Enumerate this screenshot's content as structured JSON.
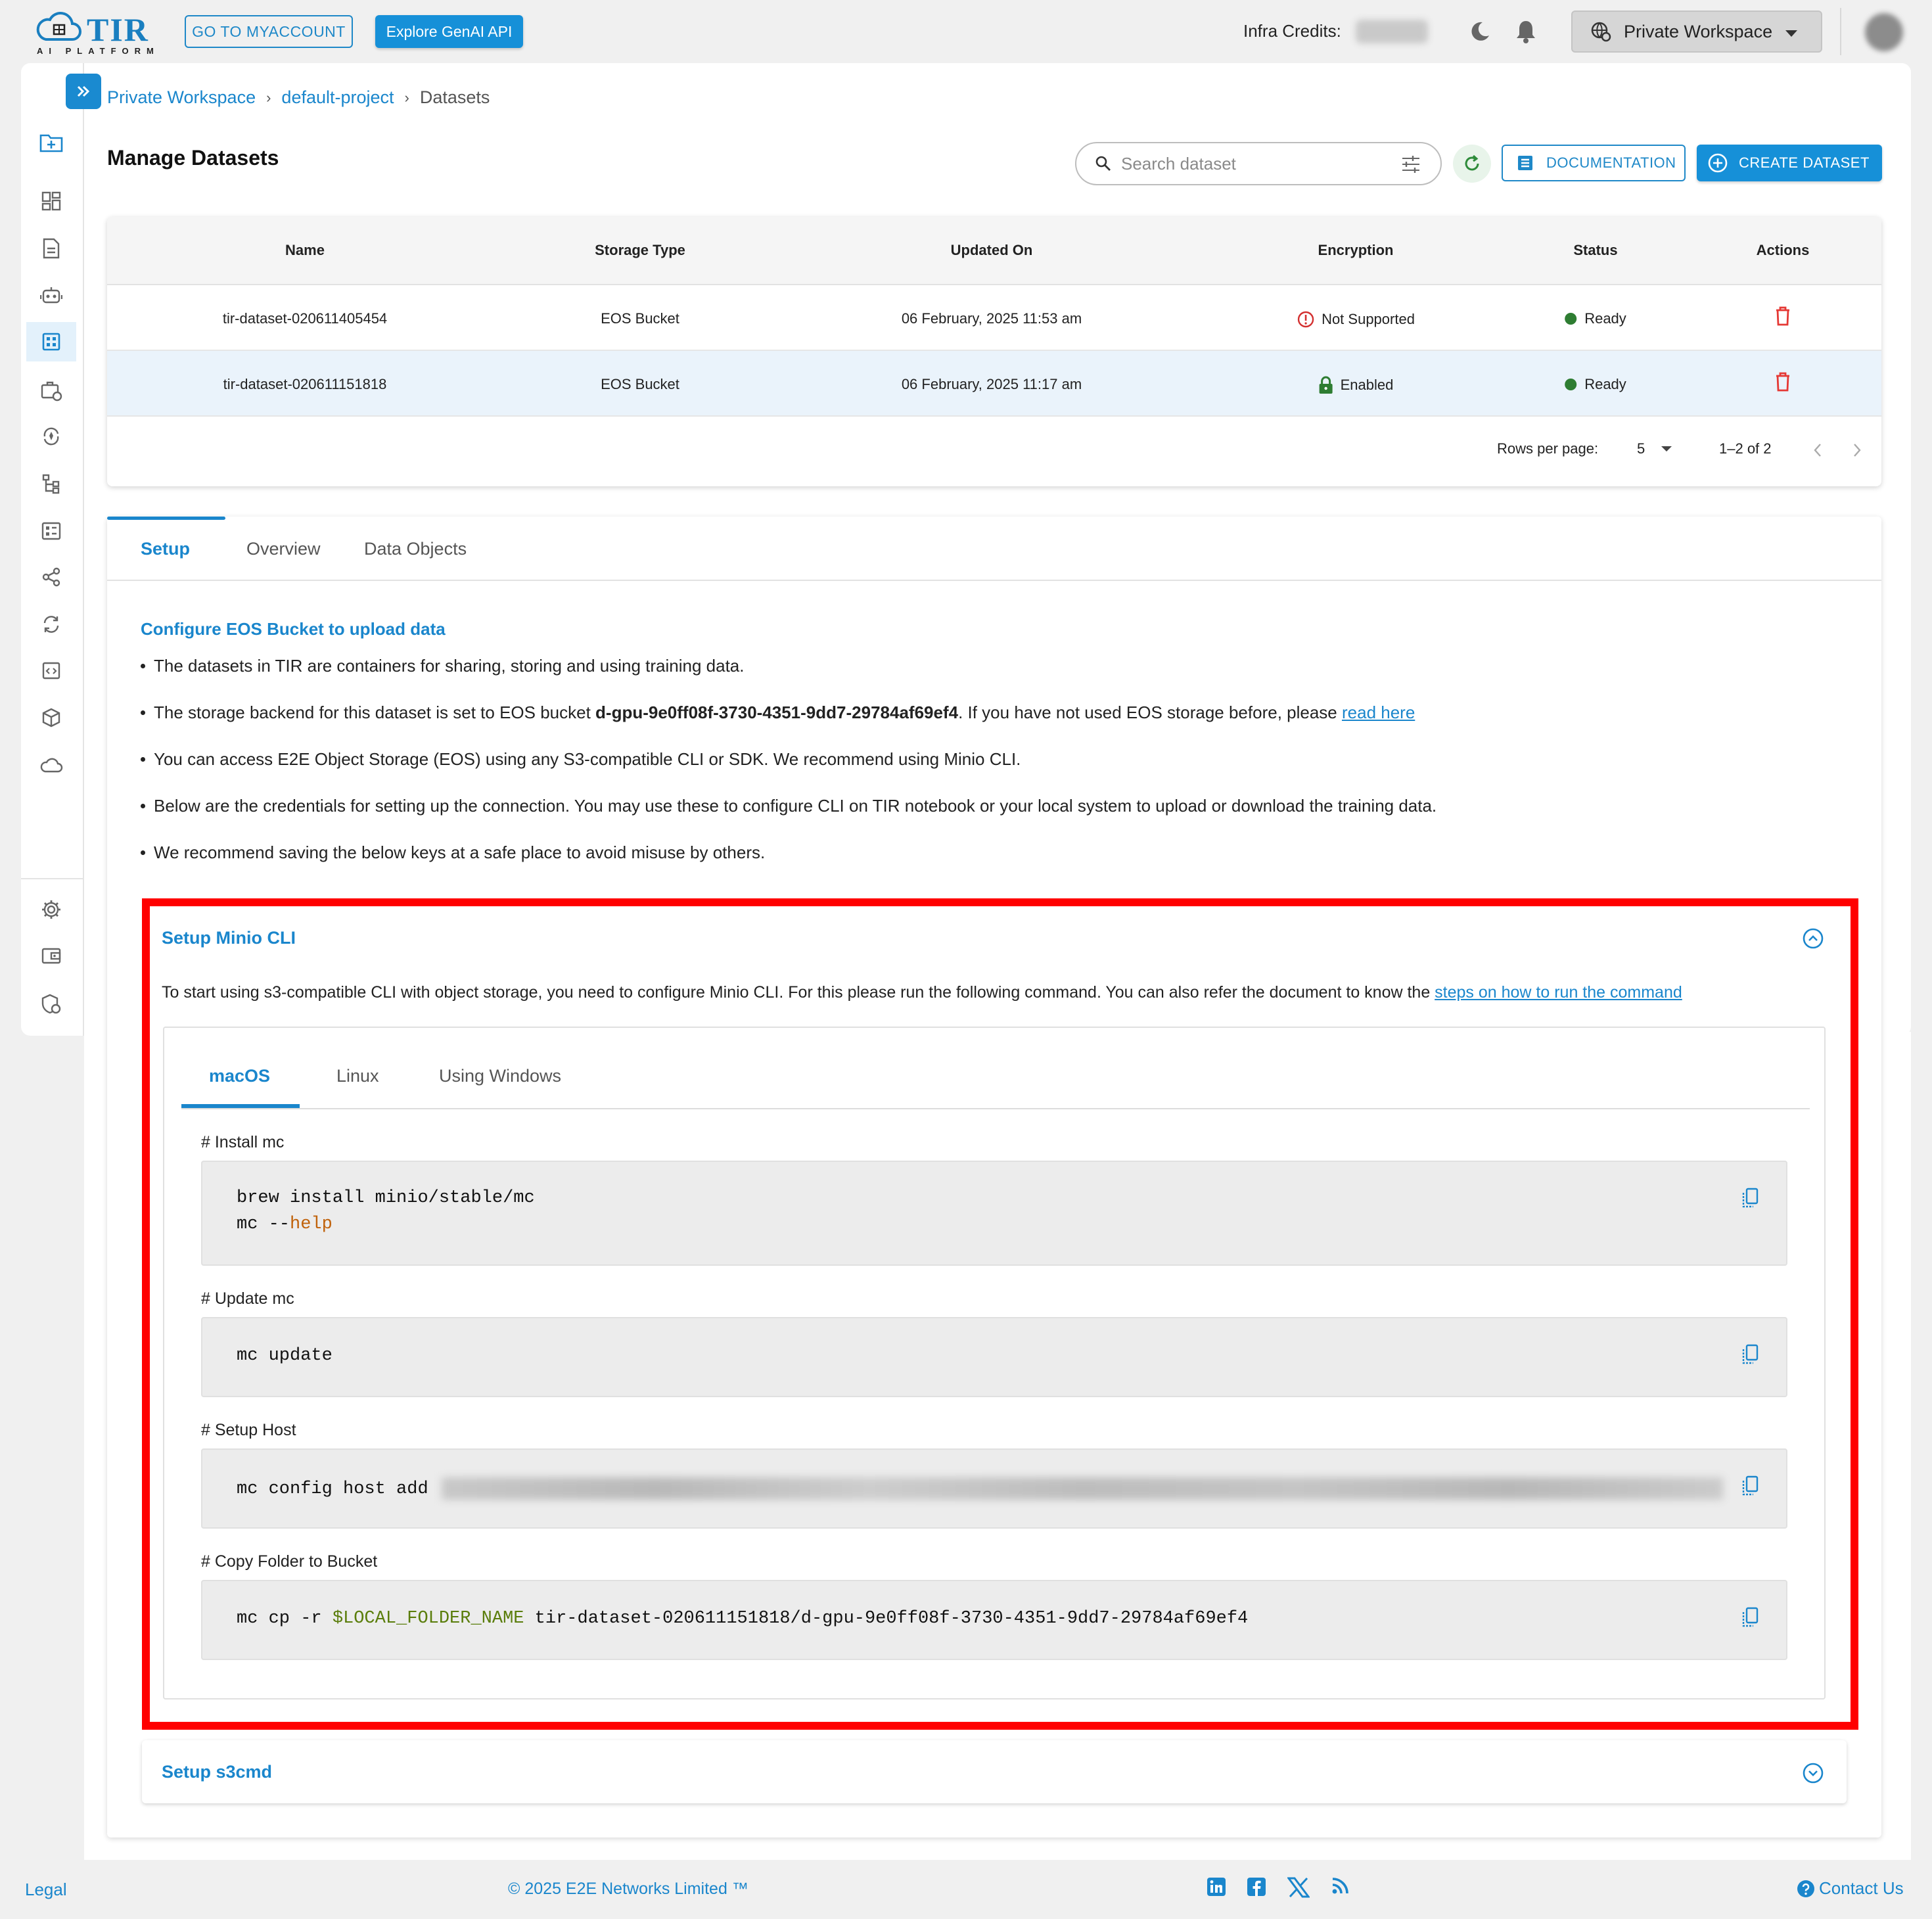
{
  "header": {
    "logo_text": "TIR",
    "logo_subtext": "AI PLATFORM",
    "myaccount_label": "GO TO MYACCOUNT",
    "genai_label": "Explore GenAI API",
    "credits_label": "Infra Credits:",
    "workspace_label": "Private Workspace"
  },
  "breadcrumb": {
    "items": [
      "Private Workspace",
      "default-project"
    ],
    "current": "Datasets",
    "separator": "›"
  },
  "page": {
    "title": "Manage Datasets",
    "search_placeholder": "Search dataset",
    "documentation_label": "DOCUMENTATION",
    "create_label": "CREATE DATASET"
  },
  "table": {
    "columns": [
      "Name",
      "Storage Type",
      "Updated On",
      "Encryption",
      "Status",
      "Actions"
    ],
    "rows": [
      {
        "name": "tir-dataset-020611405454",
        "storage": "EOS Bucket",
        "updated": "06 February, 2025 11:53 am",
        "encryption": "Not Supported",
        "status": "Ready"
      },
      {
        "name": "tir-dataset-020611151818",
        "storage": "EOS Bucket",
        "updated": "06 February, 2025 11:17 am",
        "encryption": "Enabled",
        "status": "Ready"
      }
    ],
    "rows_per_page_label": "Rows per page:",
    "rows_per_page_value": "5",
    "range": "1–2 of 2"
  },
  "details": {
    "tabs": [
      "Setup",
      "Overview",
      "Data Objects"
    ],
    "section_title": "Configure EOS Bucket to upload data",
    "bullets": {
      "b1": "The datasets in TIR are containers for sharing, storing and using training data.",
      "b2_pre": "The storage backend for this dataset is set to EOS bucket ",
      "b2_bucket": "d-gpu-9e0ff08f-3730-4351-9dd7-29784af69ef4",
      "b2_post": ". If you have not used EOS storage before, please ",
      "b2_link": "read here",
      "b3": "You can access E2E Object Storage (EOS) using any S3-compatible CLI or SDK. We recommend using Minio CLI.",
      "b4": "Below are the credentials for setting up the connection. You may use these to configure CLI on TIR notebook or your local system to upload or download the training data.",
      "b5": "We recommend saving the below keys at a safe place to avoid misuse by others."
    },
    "minio": {
      "title": "Setup Minio CLI",
      "desc": "To start using s3-compatible CLI with object storage, you need to configure Minio CLI. For this please run the following command. You can also refer the document to know the ",
      "desc_link": "steps on how to run the command",
      "os_tabs": [
        "macOS",
        "Linux",
        "Using Windows"
      ],
      "install_label": "# Install mc",
      "install_line1": "brew install minio/stable/mc",
      "install_line2_pre": "mc --",
      "install_line2_kw": "help",
      "update_label": "# Update mc",
      "update_line": "mc update",
      "host_label": "# Setup Host",
      "host_line": "mc config host add",
      "copy_label": "# Copy Folder to Bucket",
      "copy_pre": "mc cp -r ",
      "copy_var": "$LOCAL_FOLDER_NAME",
      "copy_post": " tir-dataset-020611151818/d-gpu-9e0ff08f-3730-4351-9dd7-29784af69ef4"
    },
    "s3cmd_title": "Setup s3cmd"
  },
  "footer": {
    "legal": "Legal",
    "copyright": "© 2025 E2E Networks Limited ™",
    "contact": "Contact Us"
  },
  "colors": {
    "accent": "#1a86cc",
    "highlight_frame": "#ff0000",
    "ready": "#2e7d32",
    "delete": "#e53935"
  }
}
